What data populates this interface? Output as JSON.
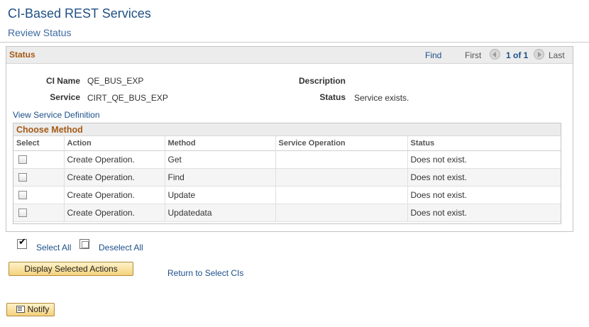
{
  "page": {
    "title": "CI-Based REST Services",
    "subtitle": "Review Status"
  },
  "status": {
    "section_title": "Status",
    "nav": {
      "find": "Find",
      "first": "First",
      "count": "1 of 1",
      "last": "Last"
    },
    "fields": {
      "ci_name_label": "CI Name",
      "ci_name_value": "QE_BUS_EXP",
      "service_label": "Service",
      "service_value": "CIRT_QE_BUS_EXP",
      "description_label": "Description",
      "description_value": "",
      "status_label": "Status",
      "status_value": "Service exists."
    },
    "view_service_definition": "View Service Definition"
  },
  "choose_method": {
    "title": "Choose Method",
    "columns": [
      "Select",
      "Action",
      "Method",
      "Service Operation",
      "Status"
    ],
    "rows": [
      {
        "selected": false,
        "action": "Create Operation.",
        "method": "Get",
        "service_operation": "",
        "status": "Does not exist."
      },
      {
        "selected": false,
        "action": "Create Operation.",
        "method": "Find",
        "service_operation": "",
        "status": "Does not exist."
      },
      {
        "selected": false,
        "action": "Create Operation.",
        "method": "Update",
        "service_operation": "",
        "status": "Does not exist."
      },
      {
        "selected": false,
        "action": "Create Operation.",
        "method": "Updatedata",
        "service_operation": "",
        "status": "Does not exist."
      }
    ]
  },
  "controls": {
    "select_all": "Select All",
    "deselect_all": "Deselect All",
    "display_selected_actions": "Display Selected Actions",
    "return_to_select_cis": "Return to Select CIs",
    "notify": "Notify"
  },
  "icons": {
    "nav_prev": "chevron-left-icon",
    "nav_next": "chevron-right-icon",
    "select_all": "checkbox-checked-icon",
    "deselect_all": "checkbox-empty-icon",
    "notify": "notify-icon"
  },
  "colors": {
    "title": "#1f4f85",
    "section_header": "#a55a17",
    "link": "#1c4f8a",
    "button_bg": "#f3d27e"
  }
}
